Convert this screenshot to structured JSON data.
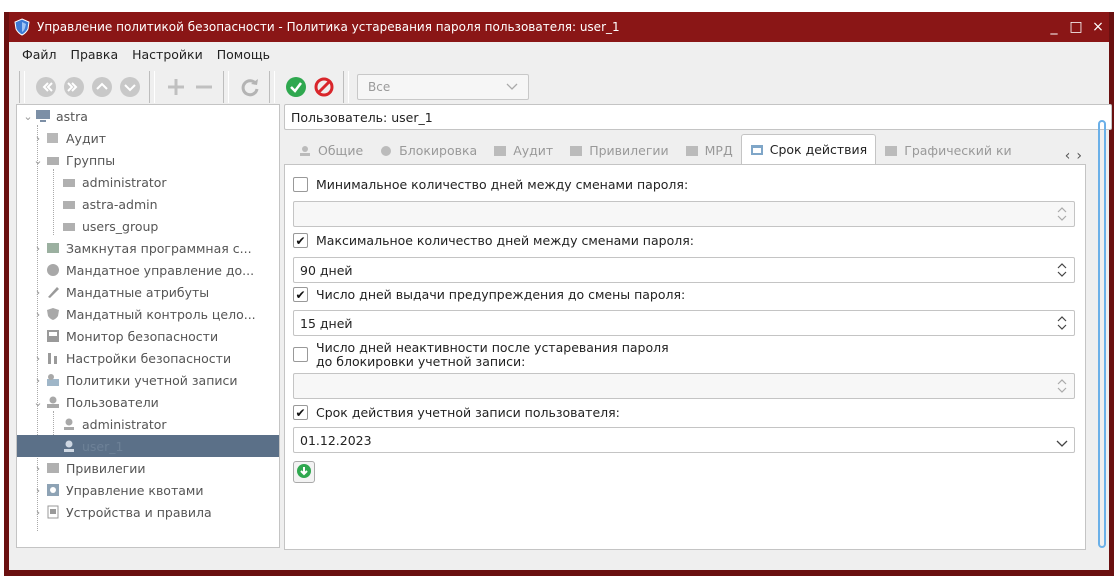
{
  "window": {
    "title": "Управление политикой безопасности - Политика устаревания пароля пользователя: user_1",
    "controls": [
      "_",
      "□",
      "×"
    ]
  },
  "menu": [
    "Файл",
    "Правка",
    "Настройки",
    "Помощь"
  ],
  "toolbar": {
    "filter_value": "Все"
  },
  "tree": {
    "items": [
      {
        "label": "astra",
        "icon": "computer-icon"
      },
      {
        "label": "Аудит",
        "icon": "audit-icon"
      },
      {
        "label": "Группы",
        "icon": "groups-icon"
      },
      {
        "label": "administrator",
        "icon": "group-icon"
      },
      {
        "label": "astra-admin",
        "icon": "group-icon"
      },
      {
        "label": "users_group",
        "icon": "group-icon"
      },
      {
        "label": "Замкнутая программная с...",
        "icon": "closed-env-icon"
      },
      {
        "label": "Мандатное управление до...",
        "icon": "mandatory-access-icon"
      },
      {
        "label": "Мандатные атрибуты",
        "icon": "mandatory-attrs-icon"
      },
      {
        "label": "Мандатный контроль цело...",
        "icon": "integrity-icon"
      },
      {
        "label": "Монитор безопасности",
        "icon": "monitor-icon"
      },
      {
        "label": "Настройки безопасности",
        "icon": "security-settings-icon"
      },
      {
        "label": "Политики учетной записи",
        "icon": "account-policy-icon"
      },
      {
        "label": "Пользователи",
        "icon": "users-icon"
      },
      {
        "label": "administrator",
        "icon": "user-icon"
      },
      {
        "label": "user_1",
        "icon": "user-icon"
      },
      {
        "label": "Привилегии",
        "icon": "privileges-icon"
      },
      {
        "label": "Управление квотами",
        "icon": "quota-icon"
      },
      {
        "label": "Устройства и правила",
        "icon": "devices-icon"
      }
    ]
  },
  "main": {
    "user_field": "Пользователь: user_1",
    "tabs": [
      {
        "label": "Общие"
      },
      {
        "label": "Блокировка"
      },
      {
        "label": "Аудит"
      },
      {
        "label": "Привилегии"
      },
      {
        "label": "МРД"
      },
      {
        "label": "Срок действия",
        "active": true
      },
      {
        "label": "Графический ки"
      }
    ],
    "min_days": {
      "label": "Минимальное количество дней между сменами пароля:",
      "checked": false,
      "value": ""
    },
    "max_days": {
      "label": "Максимальное количество дней между сменами пароля:",
      "checked": true,
      "value": "90 дней"
    },
    "warn_days": {
      "label": "Число дней выдачи предупреждения до смены пароля:",
      "checked": true,
      "value": "15 дней"
    },
    "inactive_days": {
      "label_line1": "Число дней неактивности после устаревания пароля",
      "label_line2": "до блокировки учетной записи:",
      "checked": false,
      "value": ""
    },
    "expire_date": {
      "label": "Срок действия учетной записи пользователя:",
      "checked": true,
      "value": "01.12.2023"
    }
  },
  "colors": {
    "titlebar": "#8a1616",
    "selection": "#5b7088",
    "accent_green": "#2fa84f",
    "stop_red": "#d9262b",
    "scroll_accent": "#6bb0e8"
  }
}
